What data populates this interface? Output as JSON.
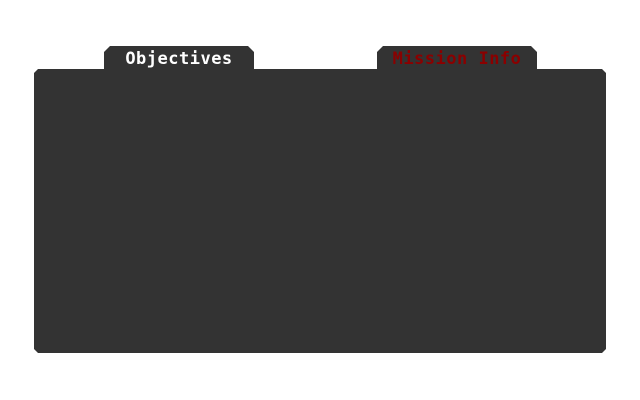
{
  "tabs": [
    {
      "label": "Objectives",
      "active": true,
      "color": "#ffffff"
    },
    {
      "label": "Mission Info",
      "active": false,
      "color": "#8b0000"
    }
  ],
  "panel": {
    "background": "#333333"
  }
}
